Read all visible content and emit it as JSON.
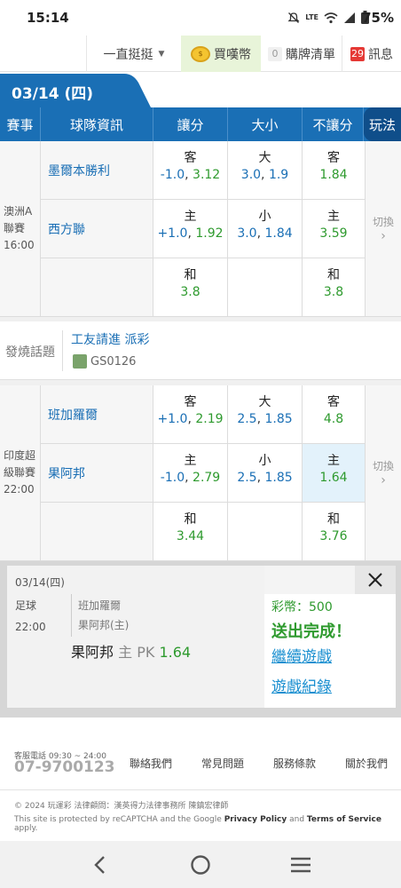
{
  "status_bar": {
    "time": "15:14",
    "battery": "75%",
    "network": "LTE"
  },
  "topnav": {
    "filter_label": "一直挺挺",
    "coins_label": "買嘆幣",
    "cart_count": "0",
    "cart_label": "購牌清單",
    "msg_count": "29",
    "msg_label": "訊息"
  },
  "date_tab": "03/14 (四)",
  "table_header": {
    "event": "賽事",
    "team_info": "球隊資訊",
    "handicap": "讓分",
    "over_under": "大小",
    "no_handicap": "不讓分",
    "play": "玩法"
  },
  "matches": [
    {
      "league": "澳洲A聯賽",
      "league_l1": "澳洲A",
      "league_l2": "聯賽",
      "time": "16:00",
      "away": "墨爾本勝利",
      "home": "西方聯",
      "switch_label": "切換",
      "handicap": {
        "away_lab": "客",
        "away_line": "-1.0",
        "away_odds": "3.12",
        "home_lab": "主",
        "home_line": "+1.0",
        "home_odds": "1.92",
        "draw_lab": "和",
        "draw_odds": "3.8"
      },
      "over_under": {
        "over_lab": "大",
        "over_line": "3.0",
        "over_odds": "1.9",
        "under_lab": "小",
        "under_line": "3.0",
        "under_odds": "1.84"
      },
      "no_handicap": {
        "away_lab": "客",
        "away_odds": "1.84",
        "home_lab": "主",
        "home_odds": "3.59",
        "draw_lab": "和",
        "draw_odds": "3.8"
      }
    },
    {
      "league": "印度超級聯賽",
      "league_l1": "印度超",
      "league_l2": "級聯賽",
      "time": "22:00",
      "away": "班加羅爾",
      "home": "果阿邦",
      "switch_label": "切換",
      "handicap": {
        "away_lab": "客",
        "away_line": "+1.0",
        "away_odds": "2.19",
        "home_lab": "主",
        "home_line": "-1.0",
        "home_odds": "2.79",
        "draw_lab": "和",
        "draw_odds": "3.44"
      },
      "over_under": {
        "over_lab": "大",
        "over_line": "2.5",
        "over_odds": "1.85",
        "under_lab": "小",
        "under_line": "2.5",
        "under_odds": "1.85"
      },
      "no_handicap": {
        "away_lab": "客",
        "away_odds": "4.8",
        "home_lab": "主",
        "home_odds": "1.64",
        "draw_lab": "和",
        "draw_odds": "3.76"
      }
    }
  ],
  "hot_topic": {
    "label": "發燒話題",
    "title": "工友請進 派彩",
    "user": "GS0126"
  },
  "ticket": {
    "date": "03/14(四)",
    "sport": "足球",
    "time": "22:00",
    "team1": "班加羅爾",
    "team2": "果阿邦(主)",
    "bet_team": "果阿邦",
    "bet_side": "主 PK",
    "bet_odds": "1.64",
    "coins": "彩幣：500",
    "done": "送出完成！",
    "continue": "繼續遊戲",
    "records": "遊戲紀錄"
  },
  "footer": {
    "phone_label": "客服電話 09:30 ~ 24:00",
    "phone": "07-9700123",
    "links": [
      "聯絡我們",
      "常見問題",
      "服務條款",
      "關於我們"
    ],
    "copyright": "© 2024 玩運彩  法律顧問：漢英得力法律事務所 陳鎮宏律師",
    "recaptcha_pre": "This site is protected by reCAPTCHA and the Google",
    "privacy": "Privacy Policy",
    "and": "and",
    "terms": "Terms of Service",
    "apply": "apply."
  },
  "colors": {
    "primary": "#1a6fb5",
    "green": "#2e9a2e",
    "red_badge": "#e53935"
  }
}
